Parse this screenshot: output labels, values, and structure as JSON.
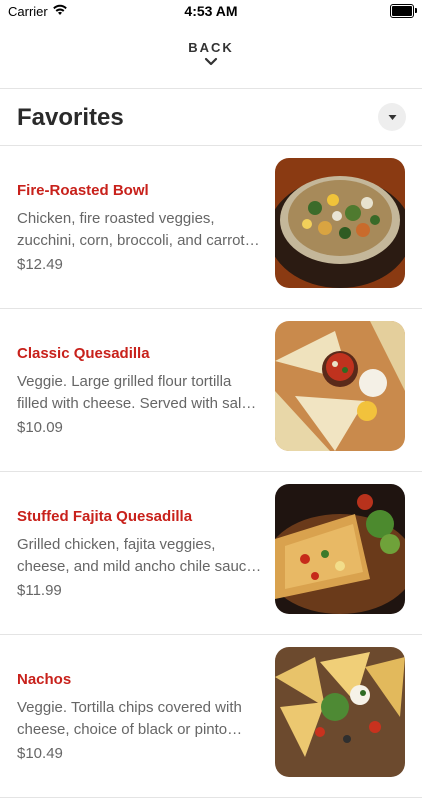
{
  "status_bar": {
    "carrier": "Carrier",
    "time": "4:53 AM"
  },
  "nav": {
    "back_label": "BACK"
  },
  "section": {
    "title": "Favorites"
  },
  "items": [
    {
      "name": "Fire-Roasted Bowl",
      "description": "Chicken, fire roasted veggies, zucchini, corn, broccoli, and carrot…",
      "price": "$12.49"
    },
    {
      "name": "Classic Quesadilla",
      "description": "Veggie. Large grilled flour tortilla filled with cheese. Served with sal…",
      "price": "$10.09"
    },
    {
      "name": "Stuffed Fajita Quesadilla",
      "description": "Grilled chicken, fajita veggies, cheese, and mild ancho chile sauc…",
      "price": "$11.99"
    },
    {
      "name": "Nachos",
      "description": "Veggie. Tortilla chips covered with cheese, choice of black or pinto be…",
      "price": "$10.49"
    }
  ],
  "colors": {
    "accent": "#c8211b",
    "text_secondary": "#666666",
    "divider": "#e4e4e4"
  }
}
